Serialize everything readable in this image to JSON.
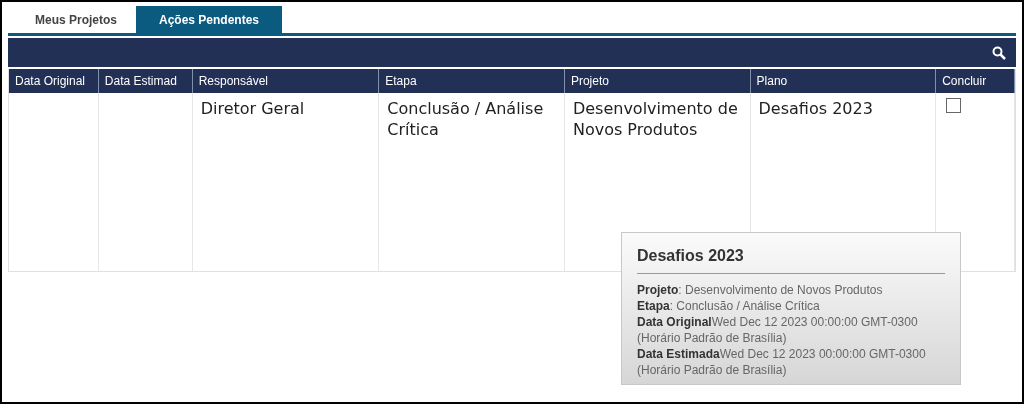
{
  "tabs": [
    {
      "label": "Meus Projetos",
      "selected": false
    },
    {
      "label": "Ações Pendentes",
      "selected": true
    }
  ],
  "table": {
    "columns": [
      "Data Original",
      "Data Estimad",
      "Responsável",
      "Etapa",
      "Projeto",
      "Plano",
      "Concluir"
    ],
    "rows": [
      {
        "cells": [
          "",
          "",
          "Diretor Geral",
          "Conclusão / Análise Crítica",
          "Desenvolvimento de Novos Produtos",
          "Desafios 2023"
        ],
        "checked": false
      }
    ]
  },
  "tooltip": {
    "title": "Desafios 2023",
    "lines": [
      "**Projeto**: Desenvolvimento de Novos Produtos",
      "**Etapa**: Conclusão / Análise Crítica",
      "**Data Original**Wed Dec 12 2023 00:00:00 GMT-0300 (Horário Padrão de Brasília)",
      "**Data Estimada**Wed Dec 12 2023 00:00:00 GMT-0300 (Horário Padrão de Brasília)"
    ]
  }
}
